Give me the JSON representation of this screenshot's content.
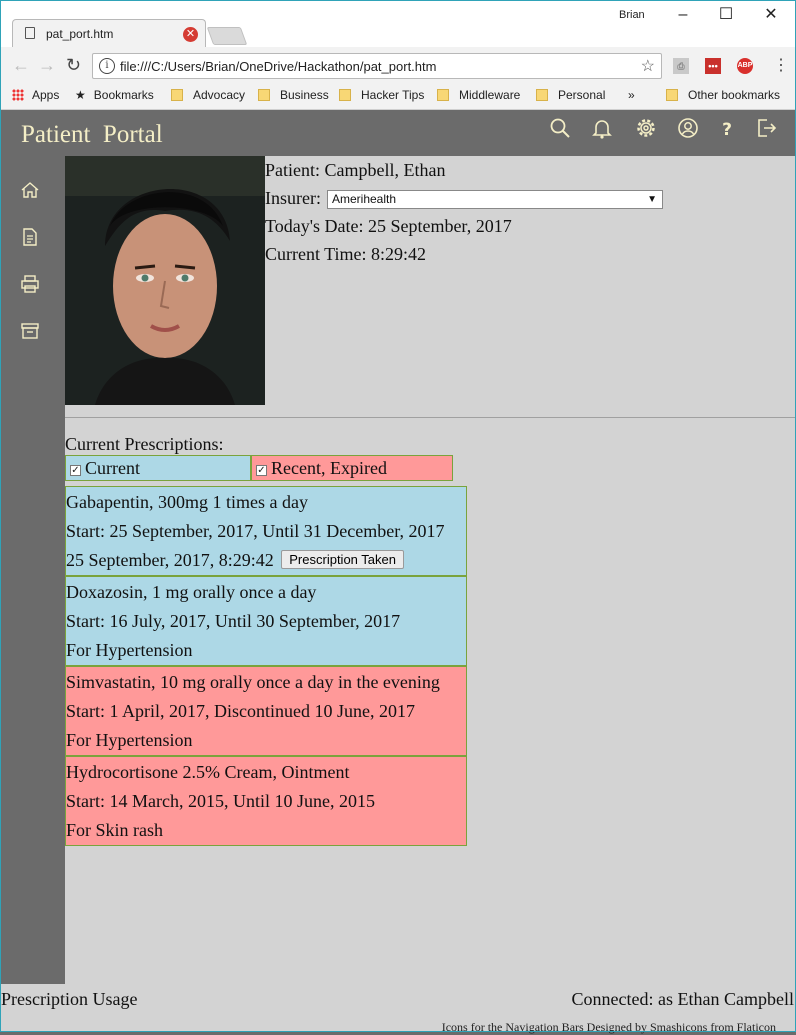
{
  "browser": {
    "tab_title": "pat_port.htm",
    "user": "Brian",
    "url": "file:///C:/Users/Brian/OneDrive/Hackathon/pat_port.htm",
    "bookmarks": [
      "Apps",
      "Bookmarks",
      "Advocacy",
      "Business",
      "Hacker Tips",
      "Middleware",
      "Personal"
    ],
    "more_bookmarks": "»",
    "other_bookmarks": "Other bookmarks"
  },
  "header": {
    "title": "Patient  Portal",
    "icons": [
      "search-icon",
      "bell-icon",
      "gear-icon",
      "user-icon",
      "help-icon",
      "logout-icon"
    ]
  },
  "sidebar": {
    "icons": [
      "home-icon",
      "report-icon",
      "printer-icon",
      "archive-icon"
    ]
  },
  "patient": {
    "name_label": "Patient: Campbell, Ethan",
    "insurer_label": "Insurer:",
    "insurer_value": "Amerihealth",
    "date_label": "Today's Date: 25 September, 2017",
    "time_label": "Current Time: 8:29:42"
  },
  "prescriptions": {
    "title": "Current Prescriptions:",
    "filters": [
      {
        "label": "Current",
        "checked": true,
        "color": "#add8e6"
      },
      {
        "label": "Recent, Expired",
        "checked": true,
        "color": "#ff9999"
      }
    ],
    "items": [
      {
        "status": "current",
        "line1": "Gabapentin, 300mg 1 times a day",
        "line2": "Start: 25 September, 2017, Until 31 December, 2017",
        "line3": "25 September, 2017, 8:29:42",
        "button": "Prescription Taken"
      },
      {
        "status": "current",
        "line1": "Doxazosin, 1 mg orally once a day",
        "line2": "Start: 16 July, 2017, Until 30 September, 2017",
        "line3": "For Hypertension"
      },
      {
        "status": "expired",
        "line1": "Simvastatin, 10 mg orally once a day in the evening",
        "line2": "Start: 1 April, 2017, Discontinued 10 June, 2017",
        "line3": "For Hypertension"
      },
      {
        "status": "expired",
        "line1": "Hydrocortisone 2.5% Cream, Ointment",
        "line2": "Start: 14 March, 2015, Until 10 June, 2015",
        "line3": "For Skin rash"
      }
    ]
  },
  "footer": {
    "left": "Prescription Usage",
    "right": "Connected: as Ethan Campbell",
    "credits": "Icons for the Navigation Bars Designed by Smashicons from Flaticon"
  }
}
